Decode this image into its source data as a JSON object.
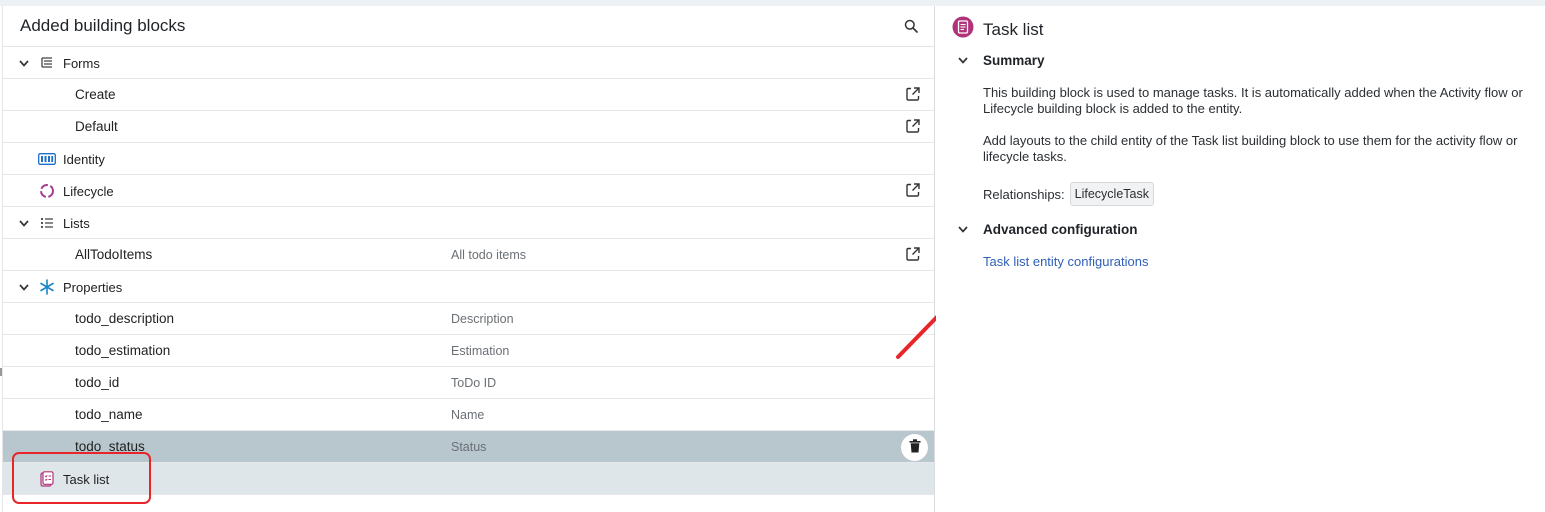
{
  "left_panel": {
    "title": "Added building blocks",
    "rows": [
      {
        "label": "Forms",
        "kind": "top",
        "chevron": true,
        "icon": "forms-icon",
        "external": false,
        "description": ""
      },
      {
        "label": "Create",
        "kind": "child",
        "chevron": false,
        "icon": "",
        "external": true,
        "description": ""
      },
      {
        "label": "Default",
        "kind": "child",
        "chevron": false,
        "icon": "",
        "external": true,
        "description": ""
      },
      {
        "label": "Identity",
        "kind": "top",
        "chevron": false,
        "icon": "identity-icon",
        "external": false,
        "description": ""
      },
      {
        "label": "Lifecycle",
        "kind": "top",
        "chevron": false,
        "icon": "lifecycle-icon",
        "external": true,
        "description": ""
      },
      {
        "label": "Lists",
        "kind": "top",
        "chevron": true,
        "icon": "list-icon",
        "external": false,
        "description": ""
      },
      {
        "label": "AllTodoItems",
        "kind": "child",
        "chevron": false,
        "icon": "",
        "external": true,
        "description": "All todo items"
      },
      {
        "label": "Properties",
        "kind": "top",
        "chevron": true,
        "icon": "properties-icon",
        "external": false,
        "description": ""
      },
      {
        "label": "todo_description",
        "kind": "child",
        "chevron": false,
        "icon": "",
        "external": false,
        "description": "Description"
      },
      {
        "label": "todo_estimation",
        "kind": "child",
        "chevron": false,
        "icon": "",
        "external": false,
        "description": "Estimation"
      },
      {
        "label": "todo_id",
        "kind": "child",
        "chevron": false,
        "icon": "",
        "external": false,
        "description": "ToDo ID"
      },
      {
        "label": "todo_name",
        "kind": "child",
        "chevron": false,
        "icon": "",
        "external": false,
        "description": "Name"
      },
      {
        "label": "todo_status",
        "kind": "child",
        "chevron": false,
        "icon": "",
        "external": false,
        "description": "Status",
        "state": "selected"
      },
      {
        "label": "Task list",
        "kind": "top",
        "chevron": false,
        "icon": "task-list-icon",
        "external": false,
        "description": "",
        "state": "highlighted"
      }
    ]
  },
  "right_panel": {
    "title": "Task list",
    "summary": {
      "heading": "Summary",
      "paragraph1": "This building block is used to manage tasks. It is automatically added when the Activity flow or Lifecycle building block is added to the entity.",
      "paragraph2": "Add layouts to the child entity of the Task list building block to use them for the activity flow or lifecycle tasks.",
      "relationships_label": "Relationships:",
      "relationship_tag": "LifecycleTask"
    },
    "advanced": {
      "heading": "Advanced configuration",
      "link": "Task list entity configurations"
    }
  },
  "colors": {
    "selected_row": "#b8c6cd",
    "highlighted_row": "#dfe6ea",
    "annotation_red": "#e8262a",
    "link_blue": "#2f5fb8",
    "task_icon_pink": "#b0337a"
  }
}
